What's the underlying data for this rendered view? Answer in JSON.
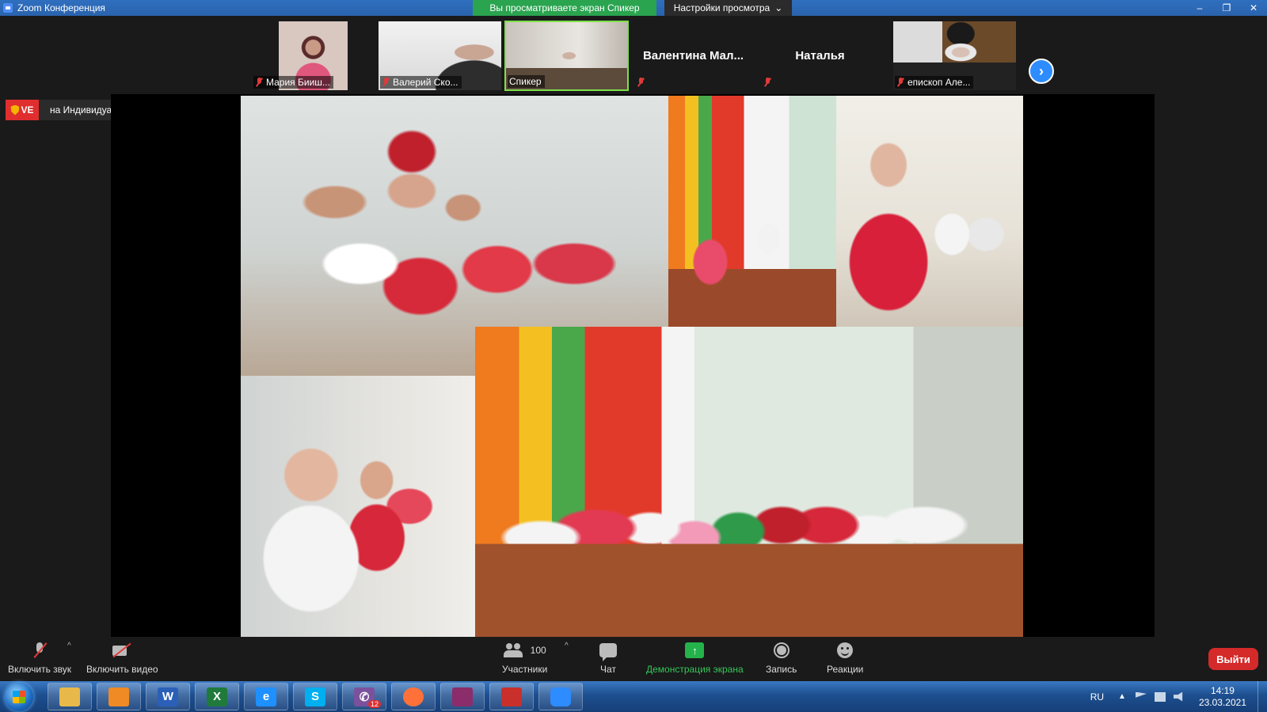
{
  "window": {
    "title": "Zoom Конференция",
    "viewing_banner": "Вы просматриваете экран Спикер",
    "view_settings": "Настройки просмотра",
    "controls": [
      "–",
      "❐",
      "✕"
    ]
  },
  "participants": [
    {
      "name": "Мария Бииш...",
      "muted": true
    },
    {
      "name": "Валерий Ско...",
      "muted": true
    },
    {
      "name": "Спикер",
      "muted": false,
      "active": true
    },
    {
      "name": "Валентина  Мал...",
      "muted": true,
      "video": false
    },
    {
      "name": "Наталья",
      "muted": true,
      "video": false
    },
    {
      "name": "епископ Але...",
      "muted": true
    }
  ],
  "live": {
    "tag": "VE",
    "stream_label": "на Индивидуальная служба потокового вещания"
  },
  "toolbar": {
    "unmute_label": "Включить звук",
    "start_video_label": "Включить видео",
    "participants_label": "Участники",
    "participants_count": "100",
    "chat_label": "Чат",
    "share_label": "Демонстрация экрана",
    "record_label": "Запись",
    "reactions_label": "Реакции",
    "leave_label": "Выйти"
  },
  "taskbar": {
    "apps": [
      {
        "name": "file-explorer",
        "color": "#e8b84a"
      },
      {
        "name": "media-player",
        "color": "#f08a24"
      },
      {
        "name": "word",
        "color": "#2b5fb8",
        "glyph": "W"
      },
      {
        "name": "excel",
        "color": "#1f7a3c",
        "glyph": "X"
      },
      {
        "name": "internet-explorer",
        "color": "#1e90ff",
        "glyph": "e"
      },
      {
        "name": "skype",
        "color": "#00aff0",
        "glyph": "S"
      },
      {
        "name": "viber",
        "color": "#7b519d",
        "glyph": "✆",
        "badge": "12"
      },
      {
        "name": "firefox",
        "color": "#ff7139"
      },
      {
        "name": "winrar",
        "color": "#8b2c6b"
      },
      {
        "name": "pdf-reader",
        "color": "#c9302c"
      },
      {
        "name": "zoom",
        "color": "#2d8cff"
      }
    ],
    "language": "RU",
    "time": "14:19",
    "date": "23.03.2021"
  }
}
